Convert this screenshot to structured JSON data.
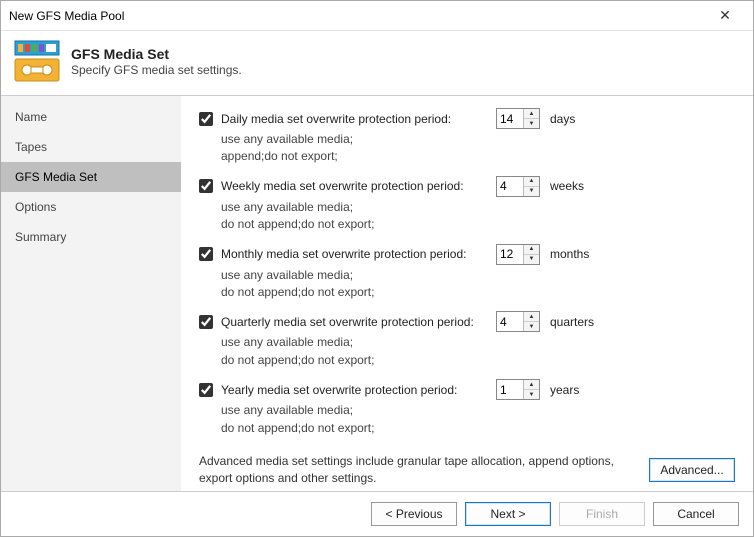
{
  "window": {
    "title": "New GFS Media Pool"
  },
  "header": {
    "title": "GFS Media Set",
    "subtitle": "Specify GFS media set settings."
  },
  "sidebar": {
    "items": [
      {
        "label": "Name",
        "active": false
      },
      {
        "label": "Tapes",
        "active": false
      },
      {
        "label": "GFS Media Set",
        "active": true
      },
      {
        "label": "Options",
        "active": false
      },
      {
        "label": "Summary",
        "active": false
      }
    ]
  },
  "mediasets": [
    {
      "label": "Daily media set overwrite protection period:",
      "value": "14",
      "unit": "days",
      "sub": "use any available media;\nappend;do not export;"
    },
    {
      "label": "Weekly media set overwrite protection period:",
      "value": "4",
      "unit": "weeks",
      "sub": "use any available media;\ndo not append;do not export;"
    },
    {
      "label": "Monthly media set overwrite protection period:",
      "value": "12",
      "unit": "months",
      "sub": "use any available media;\ndo not append;do not export;"
    },
    {
      "label": "Quarterly media set overwrite protection period:",
      "value": "4",
      "unit": "quarters",
      "sub": "use any available media;\ndo not append;do not export;"
    },
    {
      "label": "Yearly media set overwrite protection period:",
      "value": "1",
      "unit": "years",
      "sub": "use any available media;\ndo not append;do not export;"
    }
  ],
  "advanced": {
    "text": "Advanced media set settings include granular tape allocation, append options, export options and other settings.",
    "button": "Advanced..."
  },
  "footer": {
    "previous": "< Previous",
    "next": "Next >",
    "finish": "Finish",
    "cancel": "Cancel"
  }
}
